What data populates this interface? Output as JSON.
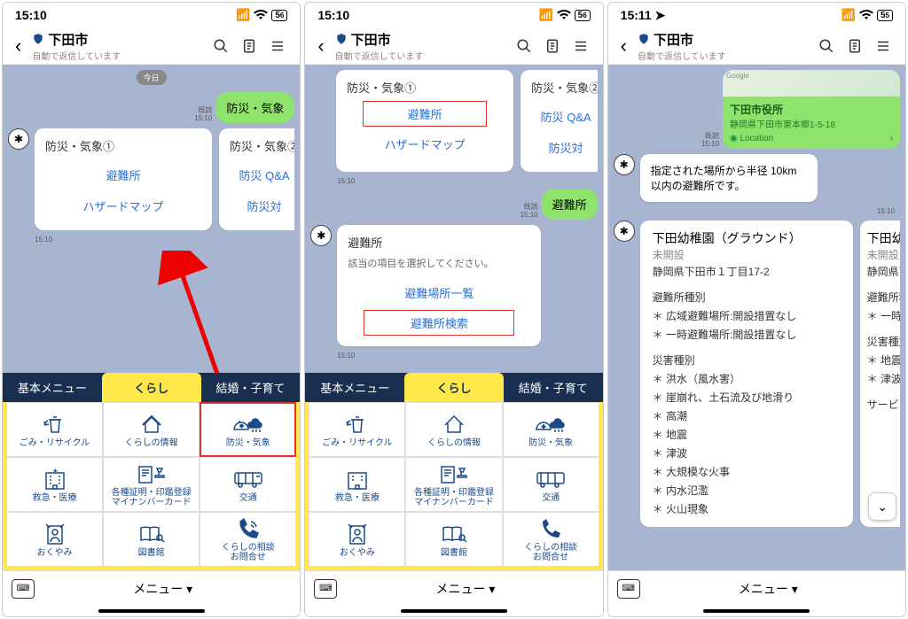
{
  "status": {
    "time1": "15:10",
    "time2": "15:10",
    "time3": "15:11",
    "signal": "••ıl",
    "wifi": "􀙇",
    "batt": "56"
  },
  "header": {
    "title": "下田市",
    "sub": "自動で返信しています"
  },
  "p1": {
    "day": "今日",
    "sent_read": "既読",
    "sent_time": "15:10",
    "sent_label": "防災・気象",
    "card1_title": "防災・気象①",
    "card1_l1": "避難所",
    "card1_l2": "ハザードマップ",
    "card2_title": "防災・気象②",
    "card2_l1": "防災 Q&A",
    "card2_l2": "防災対",
    "card_time": "15:10"
  },
  "p2": {
    "card1_title": "防災・気象①",
    "card1_l1": "避難所",
    "card1_l2": "ハザードマップ",
    "card2_title": "防災・気象②",
    "card2_l1": "防災 Q&A",
    "card2_l2": "防災対",
    "card_time": "15:10",
    "sent_read": "既読",
    "sent_time": "15:10",
    "sent_label": "避難所",
    "c2_title": "避難所",
    "c2_sub": "該当の項目を選択してください。",
    "c2_l1": "避難場所一覧",
    "c2_l2": "避難所検索",
    "c2_time": "15:10"
  },
  "p3": {
    "loc_title": "下田市役所",
    "loc_addr": "静岡県下田市東本郷1-5-18",
    "loc_footer": "Location",
    "loc_logo": "Google",
    "sent_read": "既読",
    "sent_time": "15:10",
    "msg": "指定された場所から半径 10km 以内の避難所です。",
    "msg_time": "15:10",
    "r1_title": "下田幼稚園（グラウンド）",
    "r1_status": "未開設",
    "r1_addr": "静岡県下田市１丁目17-2",
    "r1_kind_h": "避難所種別",
    "r1_k1": "＊ 広域避難場所:開設措置なし",
    "r1_k2": "＊ 一時避難場所:開設措置なし",
    "r1_dis_h": "災害種別",
    "r1_d1": "＊ 洪水（風水害）",
    "r1_d2": "＊ 崖崩れ、土石流及び地滑り",
    "r1_d3": "＊ 高潮",
    "r1_d4": "＊ 地震",
    "r1_d5": "＊ 津波",
    "r1_d6": "＊ 大規模な火事",
    "r1_d7": "＊ 内水氾濫",
    "r1_d8": "＊ 火山現象",
    "r2_title": "下田幼",
    "r2_status": "未開設",
    "r2_addr": "静岡県下",
    "r2_kind_h": "避難所種別",
    "r2_k1": "＊ 一時",
    "r2_dis_h": "災害種別",
    "r2_d1": "＊ 地震",
    "r2_d2": "＊ 津波",
    "r2_srv": "サービ"
  },
  "tabs": {
    "t1": "基本メニュー",
    "t2": "くらし",
    "t3": "結婚・子育て"
  },
  "cells": {
    "c1": "ごみ・リサイクル",
    "c2": "くらしの情報",
    "c3": "防災・気象",
    "c4": "救急・医療",
    "c5": "各種証明・印鑑登録\nマイナンバーカード",
    "c6": "交通",
    "c7": "おくやみ",
    "c8": "図書館",
    "c9": "くらしの相談\nお問合せ"
  },
  "bottom": {
    "menu": "メニュー ▾"
  }
}
